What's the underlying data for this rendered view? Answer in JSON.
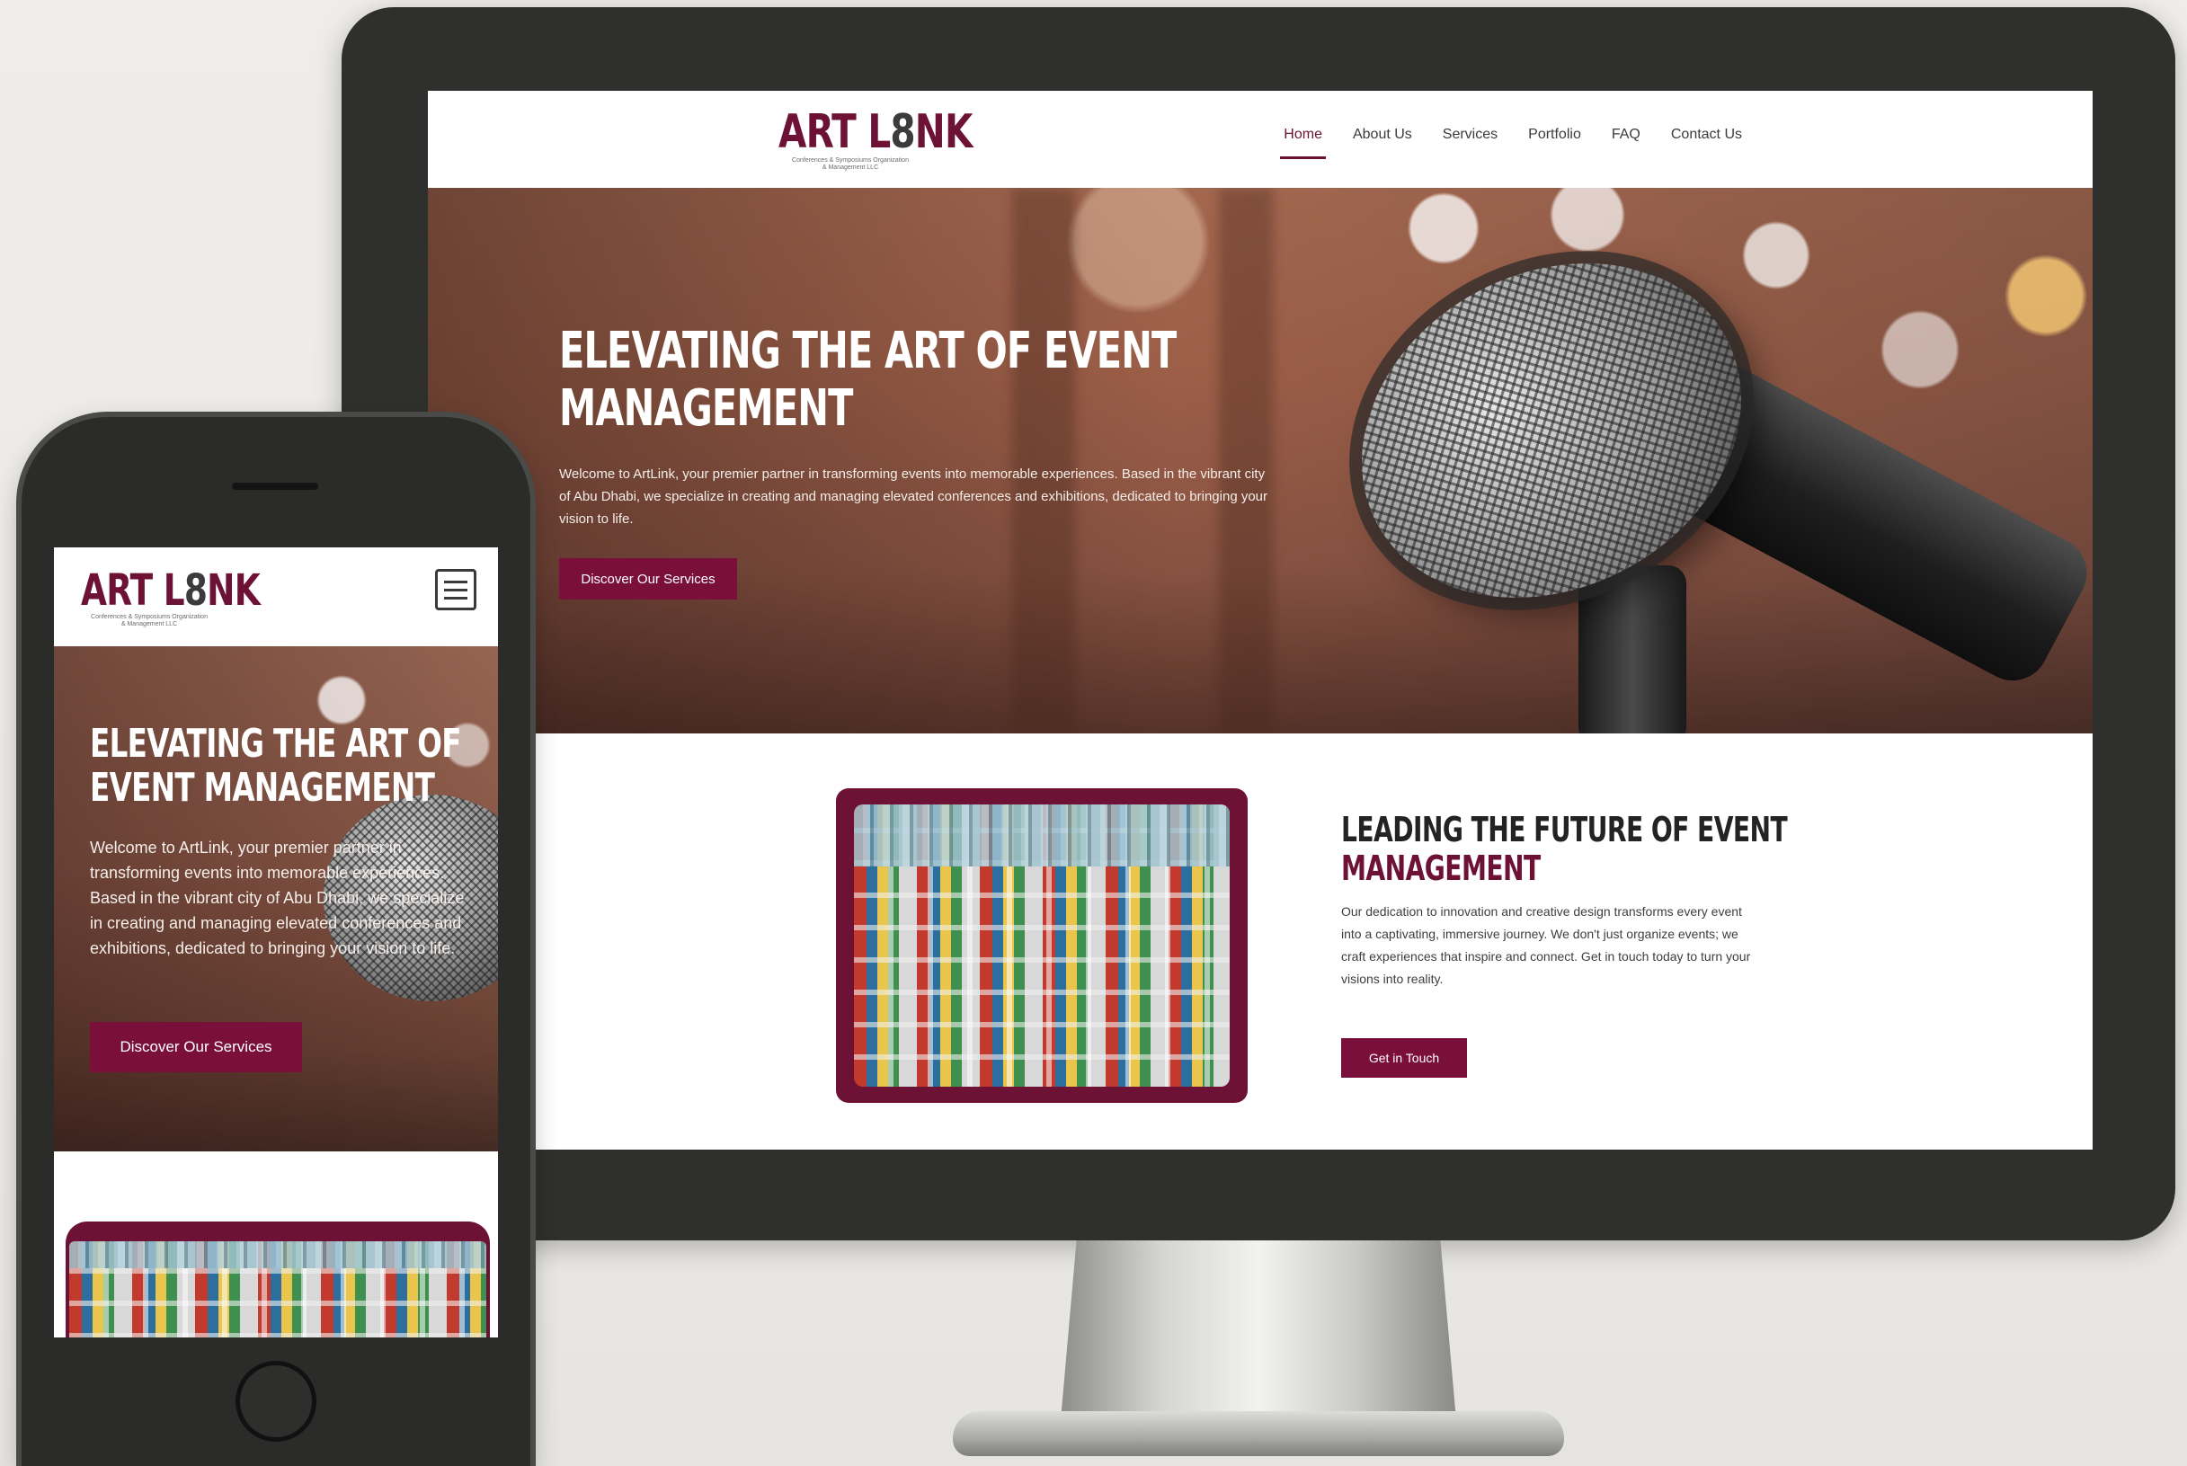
{
  "brand": {
    "logo_prefix": "ART L",
    "logo_o": "8",
    "logo_suffix": "NK",
    "logo_sub_line1": "Conferences & Symposiums Organization",
    "logo_sub_line2": "& Management LLC"
  },
  "nav": {
    "items": [
      {
        "label": "Home",
        "active": true
      },
      {
        "label": "About Us",
        "active": false
      },
      {
        "label": "Services",
        "active": false
      },
      {
        "label": "Portfolio",
        "active": false
      },
      {
        "label": "FAQ",
        "active": false
      },
      {
        "label": "Contact Us",
        "active": false
      }
    ]
  },
  "hero": {
    "title": "ELEVATING THE ART OF EVENT MANAGEMENT",
    "text": "Welcome to ArtLink, your premier partner in transforming events into memorable experiences. Based in the vibrant city of Abu Dhabi, we specialize in creating and managing elevated conferences and exhibitions, dedicated to bringing your vision to life.",
    "button": "Discover Our Services"
  },
  "section": {
    "title_line1": "LEADING THE FUTURE OF EVENT",
    "title_line2": "MANAGEMENT",
    "text": "Our dedication to innovation and creative design transforms every event into a captivating, immersive journey. We don't just organize events; we craft experiences that inspire and connect. Get in touch today to turn your visions into reality.",
    "button": "Get in Touch"
  },
  "colors": {
    "brand": "#6d1235",
    "button": "#7a0f3b",
    "device_frame": "#2f302d"
  },
  "icons": {
    "menu": "hamburger-menu-icon"
  }
}
